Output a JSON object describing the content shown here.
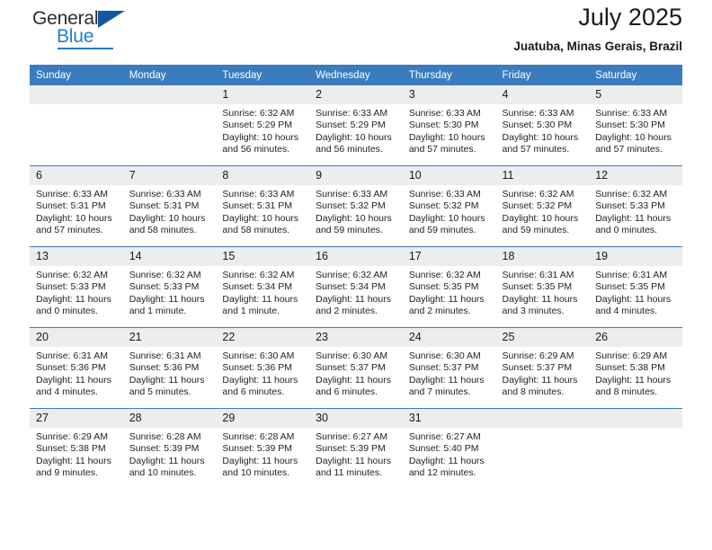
{
  "brand": {
    "name_top": "General",
    "name_bottom": "Blue",
    "accent_color": "#1f7fd0",
    "triangle_color": "#1257a0",
    "triangle_icon": "brand-triangle-icon"
  },
  "header": {
    "title": "July 2025",
    "subtitle": "Juatuba, Minas Gerais, Brazil"
  },
  "theme": {
    "header_blue": "#3a7cbe",
    "daynum_gray": "#ededed",
    "text": "#1f1f1f"
  },
  "weekday_headers": [
    "Sunday",
    "Monday",
    "Tuesday",
    "Wednesday",
    "Thursday",
    "Friday",
    "Saturday"
  ],
  "labels": {
    "sunrise_prefix": "Sunrise:",
    "sunset_prefix": "Sunset:",
    "daylight_prefix": "Daylight:"
  },
  "weeks": [
    [
      {
        "day": "",
        "sunrise": "",
        "sunset": "",
        "daylight_1": "",
        "daylight_2": ""
      },
      {
        "day": "",
        "sunrise": "",
        "sunset": "",
        "daylight_1": "",
        "daylight_2": ""
      },
      {
        "day": "1",
        "sunrise": "Sunrise: 6:32 AM",
        "sunset": "Sunset: 5:29 PM",
        "daylight_1": "Daylight: 10 hours",
        "daylight_2": "and 56 minutes."
      },
      {
        "day": "2",
        "sunrise": "Sunrise: 6:33 AM",
        "sunset": "Sunset: 5:29 PM",
        "daylight_1": "Daylight: 10 hours",
        "daylight_2": "and 56 minutes."
      },
      {
        "day": "3",
        "sunrise": "Sunrise: 6:33 AM",
        "sunset": "Sunset: 5:30 PM",
        "daylight_1": "Daylight: 10 hours",
        "daylight_2": "and 57 minutes."
      },
      {
        "day": "4",
        "sunrise": "Sunrise: 6:33 AM",
        "sunset": "Sunset: 5:30 PM",
        "daylight_1": "Daylight: 10 hours",
        "daylight_2": "and 57 minutes."
      },
      {
        "day": "5",
        "sunrise": "Sunrise: 6:33 AM",
        "sunset": "Sunset: 5:30 PM",
        "daylight_1": "Daylight: 10 hours",
        "daylight_2": "and 57 minutes."
      }
    ],
    [
      {
        "day": "6",
        "sunrise": "Sunrise: 6:33 AM",
        "sunset": "Sunset: 5:31 PM",
        "daylight_1": "Daylight: 10 hours",
        "daylight_2": "and 57 minutes."
      },
      {
        "day": "7",
        "sunrise": "Sunrise: 6:33 AM",
        "sunset": "Sunset: 5:31 PM",
        "daylight_1": "Daylight: 10 hours",
        "daylight_2": "and 58 minutes."
      },
      {
        "day": "8",
        "sunrise": "Sunrise: 6:33 AM",
        "sunset": "Sunset: 5:31 PM",
        "daylight_1": "Daylight: 10 hours",
        "daylight_2": "and 58 minutes."
      },
      {
        "day": "9",
        "sunrise": "Sunrise: 6:33 AM",
        "sunset": "Sunset: 5:32 PM",
        "daylight_1": "Daylight: 10 hours",
        "daylight_2": "and 59 minutes."
      },
      {
        "day": "10",
        "sunrise": "Sunrise: 6:33 AM",
        "sunset": "Sunset: 5:32 PM",
        "daylight_1": "Daylight: 10 hours",
        "daylight_2": "and 59 minutes."
      },
      {
        "day": "11",
        "sunrise": "Sunrise: 6:32 AM",
        "sunset": "Sunset: 5:32 PM",
        "daylight_1": "Daylight: 10 hours",
        "daylight_2": "and 59 minutes."
      },
      {
        "day": "12",
        "sunrise": "Sunrise: 6:32 AM",
        "sunset": "Sunset: 5:33 PM",
        "daylight_1": "Daylight: 11 hours",
        "daylight_2": "and 0 minutes."
      }
    ],
    [
      {
        "day": "13",
        "sunrise": "Sunrise: 6:32 AM",
        "sunset": "Sunset: 5:33 PM",
        "daylight_1": "Daylight: 11 hours",
        "daylight_2": "and 0 minutes."
      },
      {
        "day": "14",
        "sunrise": "Sunrise: 6:32 AM",
        "sunset": "Sunset: 5:33 PM",
        "daylight_1": "Daylight: 11 hours",
        "daylight_2": "and 1 minute."
      },
      {
        "day": "15",
        "sunrise": "Sunrise: 6:32 AM",
        "sunset": "Sunset: 5:34 PM",
        "daylight_1": "Daylight: 11 hours",
        "daylight_2": "and 1 minute."
      },
      {
        "day": "16",
        "sunrise": "Sunrise: 6:32 AM",
        "sunset": "Sunset: 5:34 PM",
        "daylight_1": "Daylight: 11 hours",
        "daylight_2": "and 2 minutes."
      },
      {
        "day": "17",
        "sunrise": "Sunrise: 6:32 AM",
        "sunset": "Sunset: 5:35 PM",
        "daylight_1": "Daylight: 11 hours",
        "daylight_2": "and 2 minutes."
      },
      {
        "day": "18",
        "sunrise": "Sunrise: 6:31 AM",
        "sunset": "Sunset: 5:35 PM",
        "daylight_1": "Daylight: 11 hours",
        "daylight_2": "and 3 minutes."
      },
      {
        "day": "19",
        "sunrise": "Sunrise: 6:31 AM",
        "sunset": "Sunset: 5:35 PM",
        "daylight_1": "Daylight: 11 hours",
        "daylight_2": "and 4 minutes."
      }
    ],
    [
      {
        "day": "20",
        "sunrise": "Sunrise: 6:31 AM",
        "sunset": "Sunset: 5:36 PM",
        "daylight_1": "Daylight: 11 hours",
        "daylight_2": "and 4 minutes."
      },
      {
        "day": "21",
        "sunrise": "Sunrise: 6:31 AM",
        "sunset": "Sunset: 5:36 PM",
        "daylight_1": "Daylight: 11 hours",
        "daylight_2": "and 5 minutes."
      },
      {
        "day": "22",
        "sunrise": "Sunrise: 6:30 AM",
        "sunset": "Sunset: 5:36 PM",
        "daylight_1": "Daylight: 11 hours",
        "daylight_2": "and 6 minutes."
      },
      {
        "day": "23",
        "sunrise": "Sunrise: 6:30 AM",
        "sunset": "Sunset: 5:37 PM",
        "daylight_1": "Daylight: 11 hours",
        "daylight_2": "and 6 minutes."
      },
      {
        "day": "24",
        "sunrise": "Sunrise: 6:30 AM",
        "sunset": "Sunset: 5:37 PM",
        "daylight_1": "Daylight: 11 hours",
        "daylight_2": "and 7 minutes."
      },
      {
        "day": "25",
        "sunrise": "Sunrise: 6:29 AM",
        "sunset": "Sunset: 5:37 PM",
        "daylight_1": "Daylight: 11 hours",
        "daylight_2": "and 8 minutes."
      },
      {
        "day": "26",
        "sunrise": "Sunrise: 6:29 AM",
        "sunset": "Sunset: 5:38 PM",
        "daylight_1": "Daylight: 11 hours",
        "daylight_2": "and 8 minutes."
      }
    ],
    [
      {
        "day": "27",
        "sunrise": "Sunrise: 6:29 AM",
        "sunset": "Sunset: 5:38 PM",
        "daylight_1": "Daylight: 11 hours",
        "daylight_2": "and 9 minutes."
      },
      {
        "day": "28",
        "sunrise": "Sunrise: 6:28 AM",
        "sunset": "Sunset: 5:39 PM",
        "daylight_1": "Daylight: 11 hours",
        "daylight_2": "and 10 minutes."
      },
      {
        "day": "29",
        "sunrise": "Sunrise: 6:28 AM",
        "sunset": "Sunset: 5:39 PM",
        "daylight_1": "Daylight: 11 hours",
        "daylight_2": "and 10 minutes."
      },
      {
        "day": "30",
        "sunrise": "Sunrise: 6:27 AM",
        "sunset": "Sunset: 5:39 PM",
        "daylight_1": "Daylight: 11 hours",
        "daylight_2": "and 11 minutes."
      },
      {
        "day": "31",
        "sunrise": "Sunrise: 6:27 AM",
        "sunset": "Sunset: 5:40 PM",
        "daylight_1": "Daylight: 11 hours",
        "daylight_2": "and 12 minutes."
      },
      {
        "day": "",
        "sunrise": "",
        "sunset": "",
        "daylight_1": "",
        "daylight_2": ""
      },
      {
        "day": "",
        "sunrise": "",
        "sunset": "",
        "daylight_1": "",
        "daylight_2": ""
      }
    ]
  ]
}
